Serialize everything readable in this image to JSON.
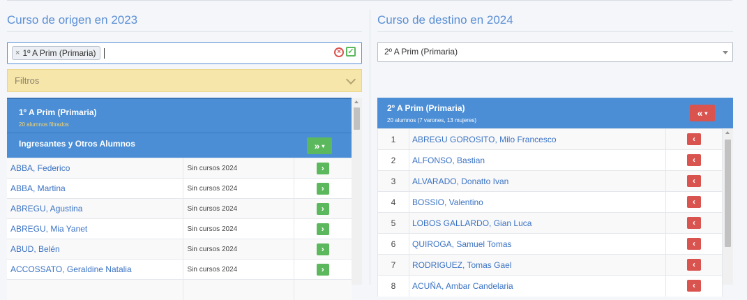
{
  "origin": {
    "title": "Curso de origen en 2023",
    "selected_chip": "1º A Prim (Primaria)",
    "chip_remove": "×",
    "clear_icon": "x-circle-icon",
    "confirm_icon": "check-square-icon",
    "filters_label": "Filtros",
    "panel": {
      "name": "1º A Prim (Primaria)",
      "subtitle": "20 alumnos filtrados",
      "group_label": "Ingresantes y Otros Alumnos",
      "move_all_icon": "double-chevron-right-icon"
    },
    "students": [
      {
        "name": "ABBA, Federico",
        "status": "Sin cursos 2024"
      },
      {
        "name": "ABBA, Martina",
        "status": "Sin cursos 2024"
      },
      {
        "name": "ABREGU, Agustina",
        "status": "Sin cursos 2024"
      },
      {
        "name": "ABREGU, Mia Yanet",
        "status": "Sin cursos 2024"
      },
      {
        "name": "ABUD, Belén",
        "status": "Sin cursos 2024"
      },
      {
        "name": "ACCOSSATO, Geraldine Natalia",
        "status": "Sin cursos 2024"
      },
      {
        "name": "",
        "status": ""
      }
    ]
  },
  "destination": {
    "title": "Curso de destino en 2024",
    "selected": "2º A Prim (Primaria)",
    "panel": {
      "name": "2º A Prim (Primaria)",
      "subtitle": "20 alumnos (7 varones, 13 mujeres)",
      "move_all_icon": "double-chevron-left-icon"
    },
    "students": [
      {
        "index": "1",
        "name": "ABREGU GOROSITO, Milo Francesco"
      },
      {
        "index": "2",
        "name": "ALFONSO, Bastian"
      },
      {
        "index": "3",
        "name": "ALVARADO, Donatto Ivan"
      },
      {
        "index": "4",
        "name": "BOSSIO, Valentino"
      },
      {
        "index": "5",
        "name": "LOBOS GALLARDO, Gian Luca"
      },
      {
        "index": "6",
        "name": "QUIROGA, Samuel Tomas"
      },
      {
        "index": "7",
        "name": "RODRIGUEZ, Tomas Gael"
      },
      {
        "index": "8",
        "name": "ACUÑA, Ambar Candelaria"
      }
    ]
  },
  "colors": {
    "accent": "#4b8ed6",
    "title_blue": "#5b8fd6",
    "filters_bg": "#f7e6a9",
    "green": "#5cb85c",
    "red": "#d9534f",
    "link": "#3b73c4"
  }
}
